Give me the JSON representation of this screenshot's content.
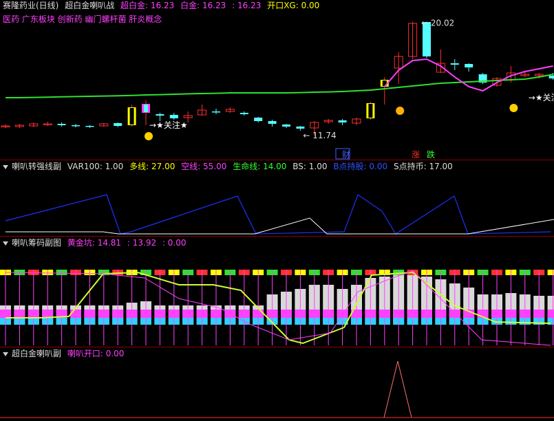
{
  "main": {
    "title": "赛隆药业(日线)",
    "indicator": "超白金喇叭战",
    "fields": [
      {
        "label": "超白金: 16.23",
        "color": "#ff40ff"
      },
      {
        "label": "白金: 16.23",
        "color": "#ff40ff"
      },
      {
        "label": ": 16.23",
        "color": "#ff40ff"
      },
      {
        "label": "开口XG: 0.00",
        "color": "#ffff00"
      }
    ],
    "concepts": "医药 广东板块 创新药 幽门螺杆菌 肝炎概念",
    "high_label": "20.02",
    "low_label": "11.74",
    "focus_label": "关注",
    "badges": [
      {
        "text": "财",
        "color": "#4060ff"
      },
      {
        "text": "涨",
        "color": "#ff3030"
      },
      {
        "text": "跌",
        "color": "#30ff30"
      }
    ],
    "colors": {
      "up": "#ff3030",
      "down": "#55ffff",
      "yellow": "#ffff00",
      "pink": "#ff40ff",
      "green": "#30e030"
    }
  },
  "sub1": {
    "title": "喇叭转强线副",
    "fields": [
      {
        "label": "VAR100: 1.00",
        "color": "#dddddd"
      },
      {
        "label": "多线: 27.00",
        "color": "#ffff00"
      },
      {
        "label": "空线: 55.00",
        "color": "#ff40ff"
      },
      {
        "label": "生命线: 14.00",
        "color": "#30ff30"
      },
      {
        "label": "BS: 1.00",
        "color": "#dddddd"
      },
      {
        "label": "B点持股: 0.00",
        "color": "#3050ff"
      },
      {
        "label": "S点持币: 17.00",
        "color": "#dddddd"
      }
    ]
  },
  "sub2": {
    "title": "喇叭筹码副图",
    "fields": [
      {
        "label": "黄金坑: 14.81",
        "color": "#ff40ff"
      },
      {
        "label": ": 13.92",
        "color": "#ff40ff"
      },
      {
        "label": ": 0.00",
        "color": "#ff40ff"
      }
    ]
  },
  "sub3": {
    "title": "超白金喇叭副",
    "fields": [
      {
        "label": "喇叭开口: 0.00",
        "color": "#ff40ff"
      }
    ]
  },
  "chart_data": {
    "type": "candlestick",
    "price_range": [
      11.0,
      21.0
    ],
    "candles": [
      {
        "o": 12.4,
        "c": 12.45,
        "h": 12.55,
        "l": 12.3
      },
      {
        "o": 12.4,
        "c": 12.5,
        "h": 12.6,
        "l": 12.3
      },
      {
        "o": 12.45,
        "c": 12.6,
        "h": 12.7,
        "l": 12.35
      },
      {
        "o": 12.55,
        "c": 12.6,
        "h": 12.75,
        "l": 12.45
      },
      {
        "o": 12.6,
        "c": 12.5,
        "h": 12.7,
        "l": 12.4
      },
      {
        "o": 12.5,
        "c": 12.45,
        "h": 12.6,
        "l": 12.35
      },
      {
        "o": 12.45,
        "c": 12.4,
        "h": 12.5,
        "l": 12.3
      },
      {
        "o": 12.45,
        "c": 12.6,
        "h": 12.65,
        "l": 12.4
      },
      {
        "o": 12.65,
        "c": 12.45,
        "h": 12.7,
        "l": 12.35
      },
      {
        "o": 12.5,
        "c": 13.8,
        "h": 14.0,
        "l": 12.4
      },
      {
        "o": 13.4,
        "c": 14.05,
        "h": 14.3,
        "l": 12.5
      },
      {
        "o": 13.3,
        "c": 13.2,
        "h": 13.4,
        "l": 12.8
      },
      {
        "o": 13.25,
        "c": 13.0,
        "h": 13.4,
        "l": 12.9
      },
      {
        "o": 13.05,
        "c": 13.2,
        "h": 13.5,
        "l": 12.7
      },
      {
        "o": 13.25,
        "c": 13.6,
        "h": 14.0,
        "l": 13.2
      },
      {
        "o": 13.5,
        "c": 13.45,
        "h": 13.7,
        "l": 13.3
      },
      {
        "o": 13.5,
        "c": 13.65,
        "h": 13.8,
        "l": 13.4
      },
      {
        "o": 13.4,
        "c": 13.3,
        "h": 13.5,
        "l": 13.2
      },
      {
        "o": 13.05,
        "c": 12.8,
        "h": 13.1,
        "l": 12.7
      },
      {
        "o": 12.8,
        "c": 12.6,
        "h": 12.9,
        "l": 12.4
      },
      {
        "o": 12.55,
        "c": 12.4,
        "h": 12.6,
        "l": 12.3
      },
      {
        "o": 12.4,
        "c": 12.25,
        "h": 12.45,
        "l": 12.1
      },
      {
        "o": 12.3,
        "c": 12.7,
        "h": 12.8,
        "l": 11.74
      },
      {
        "o": 12.75,
        "c": 12.85,
        "h": 12.95,
        "l": 12.6
      },
      {
        "o": 12.85,
        "c": 12.7,
        "h": 12.95,
        "l": 12.5
      },
      {
        "o": 12.65,
        "c": 12.95,
        "h": 13.05,
        "l": 12.5
      },
      {
        "o": 13.0,
        "c": 14.1,
        "h": 14.2,
        "l": 12.9
      },
      {
        "o": 15.3,
        "c": 15.8,
        "h": 16.0,
        "l": 14.0
      },
      {
        "o": 16.65,
        "c": 17.5,
        "h": 17.8,
        "l": 15.5
      },
      {
        "o": 17.5,
        "c": 19.9,
        "h": 20.02,
        "l": 17.3
      },
      {
        "o": 20.0,
        "c": 17.5,
        "h": 20.02,
        "l": 17.4
      },
      {
        "o": 16.35,
        "c": 17.0,
        "h": 18.0,
        "l": 16.3
      },
      {
        "o": 17.0,
        "c": 16.9,
        "h": 17.3,
        "l": 16.5
      },
      {
        "o": 16.95,
        "c": 16.7,
        "h": 17.0,
        "l": 16.4
      },
      {
        "o": 16.2,
        "c": 15.6,
        "h": 16.3,
        "l": 15.5
      },
      {
        "o": 15.4,
        "c": 15.9,
        "h": 16.0,
        "l": 15.3
      },
      {
        "o": 15.8,
        "c": 16.3,
        "h": 16.8,
        "l": 15.6
      },
      {
        "o": 16.1,
        "c": 16.2,
        "h": 16.4,
        "l": 16.0
      },
      {
        "o": 16.1,
        "c": 16.2,
        "h": 16.3,
        "l": 15.9
      },
      {
        "o": 16.1,
        "c": 15.9,
        "h": 16.3,
        "l": 15.8
      }
    ],
    "green_line": [
      14.5,
      14.5,
      14.52,
      14.54,
      14.56,
      14.58,
      14.6,
      14.62,
      14.64,
      14.66,
      14.7,
      14.72,
      14.75,
      14.78,
      14.8,
      14.82,
      14.85,
      14.85,
      14.85,
      14.85,
      14.85,
      14.87,
      14.9,
      14.92,
      14.95,
      15.0,
      15.05,
      15.15,
      15.25,
      15.35,
      15.45,
      15.55,
      15.6,
      15.65,
      15.7,
      15.75,
      15.8,
      15.85,
      16.0,
      16.2
    ],
    "pink_line": [
      null,
      null,
      null,
      null,
      null,
      null,
      null,
      null,
      null,
      null,
      null,
      null,
      null,
      null,
      null,
      null,
      null,
      null,
      null,
      null,
      null,
      null,
      null,
      null,
      null,
      null,
      null,
      15.3,
      16.5,
      17.2,
      17.3,
      16.8,
      16.0,
      15.3,
      15.0,
      15.6,
      16.1,
      16.4,
      16.6,
      16.8
    ]
  }
}
